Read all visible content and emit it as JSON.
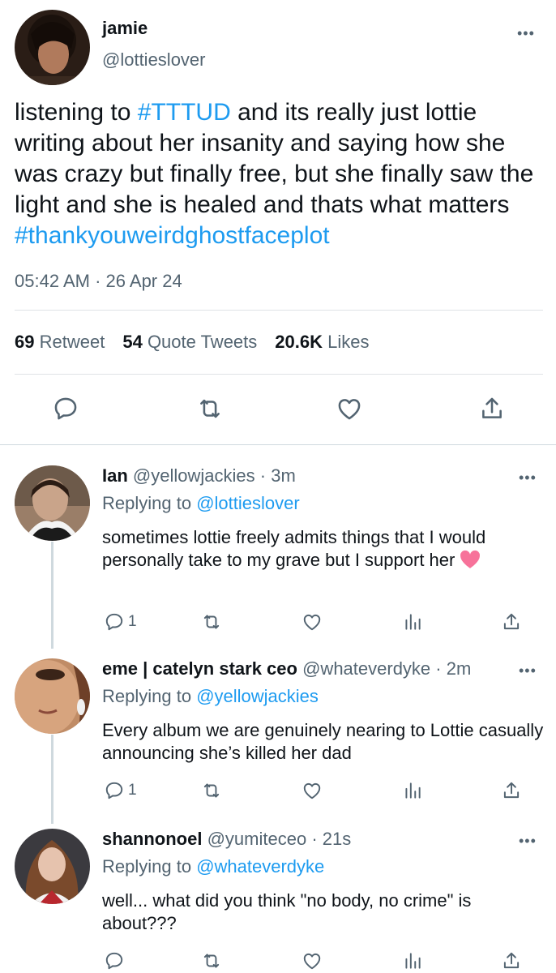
{
  "main_tweet": {
    "name": "jamie",
    "handle": "@lottieslover",
    "text_1": "listening to ",
    "hashtag_1": "#TTTUD",
    "text_2": " and its really just lottie writing about her insanity and saying how she was crazy but finally free, but she finally saw the light and she is healed and thats what matters ",
    "hashtag_2": "#thankyouweirdghostfaceplot",
    "time": "05:42 AM",
    "date": "26 Apr 24",
    "retweets": "69",
    "retweets_label": "Retweet",
    "quotes": "54",
    "quotes_label": "Quote Tweets",
    "likes": "20.6K",
    "likes_label": "Likes",
    "actions": [
      "reply-icon",
      "retweet-icon",
      "like-icon",
      "share-icon"
    ]
  },
  "replies": [
    {
      "name": "Ian",
      "handle": "@yellowjackies",
      "time": "3m",
      "replying_label": "Replying to ",
      "replying_to": "@lottieslover",
      "text": "sometimes lottie freely admits things that I would personally take to my grave but I support her",
      "emoji": "pink-heart-icon",
      "reply_count": "1"
    },
    {
      "name": "eme | catelyn stark ceo",
      "handle": "@whateverdyke",
      "time": "2m",
      "replying_label": "Replying to ",
      "replying_to": "@yellowjackies",
      "text": "Every album we are genuinely nearing to Lottie casually announcing she’s killed her dad",
      "reply_count": "1"
    },
    {
      "name": "shannonoel",
      "handle": "@yumiteceo",
      "time": "21s",
      "replying_label": "Replying to ",
      "replying_to": "@whateverdyke",
      "text": "well... what did you think \"no body, no crime\" is about???",
      "reply_count": ""
    }
  ],
  "ui": {
    "more_label": "•••",
    "separator": "·"
  },
  "colors": {
    "link": "#1d9bf0",
    "secondary": "#536471",
    "text": "#0f1419",
    "heart_emoji": "#f7729a"
  }
}
